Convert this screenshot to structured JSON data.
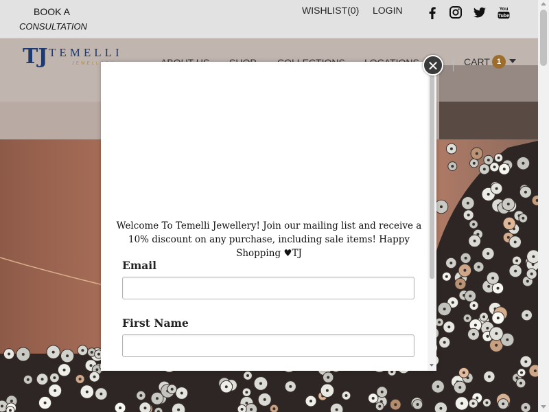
{
  "topbar": {
    "book_line1": "BOOK A",
    "book_line2": "CONSULTATION",
    "wishlist": "WISHLIST(0)",
    "login": "LOGIN",
    "social": [
      "facebook-icon",
      "instagram-icon",
      "twitter-icon",
      "youtube-icon"
    ]
  },
  "logo": {
    "symbol": "TJ",
    "name": "TEMELLI",
    "tagline": "JEWELLERY"
  },
  "nav": {
    "items": [
      "ABOUT US",
      "SHOP",
      "COLLECTIONS",
      "LOCATIONS"
    ],
    "cart_label": "CART",
    "cart_count": "1"
  },
  "colors": {
    "accent": "#9c6d2d",
    "topbar": "#e2e2e2",
    "logo_blue": "#1e3a6e"
  },
  "modal": {
    "welcome": "Welcome To Temelli Jewellery! Join our mailing list and receive a 10% discount on any purchase, including sale items! Happy Shopping ♥TJ",
    "email_label": "Email",
    "first_name_label": "First Name",
    "email_value": "",
    "first_name_value": "",
    "close": "✕"
  }
}
